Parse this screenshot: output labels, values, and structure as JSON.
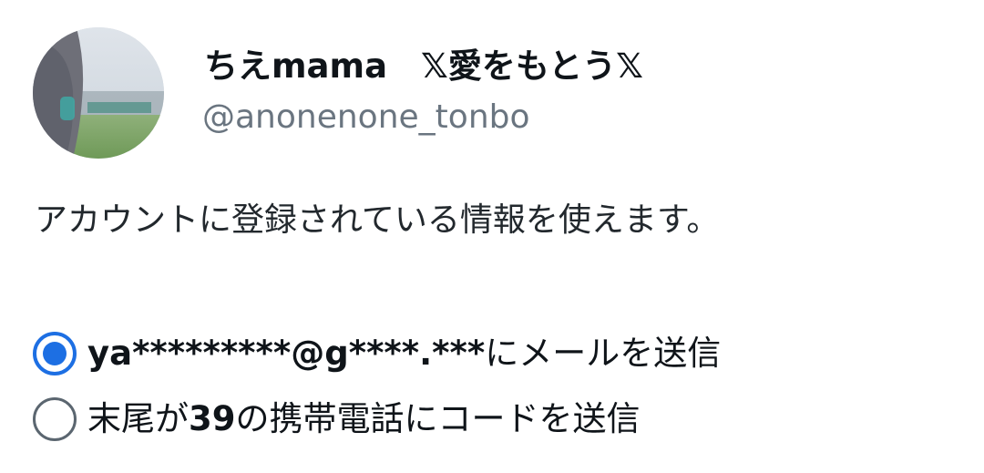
{
  "account": {
    "display_name": "ちえmama　𝕏愛をもとう𝕏",
    "handle": "@anonenone_tonbo"
  },
  "info_text": "アカウントに登録されている情報を使えます。",
  "options": [
    {
      "bold_part": "ya*********@g****.***",
      "normal_part": "にメールを送信",
      "selected": true
    },
    {
      "normal_prefix": "末尾が",
      "bold_part": "39",
      "normal_part": "の携帯電話にコードを送信",
      "selected": false
    }
  ],
  "colors": {
    "accent": "#1d6fe3",
    "handle_gray": "#6a7580",
    "text": "#0f1419"
  }
}
